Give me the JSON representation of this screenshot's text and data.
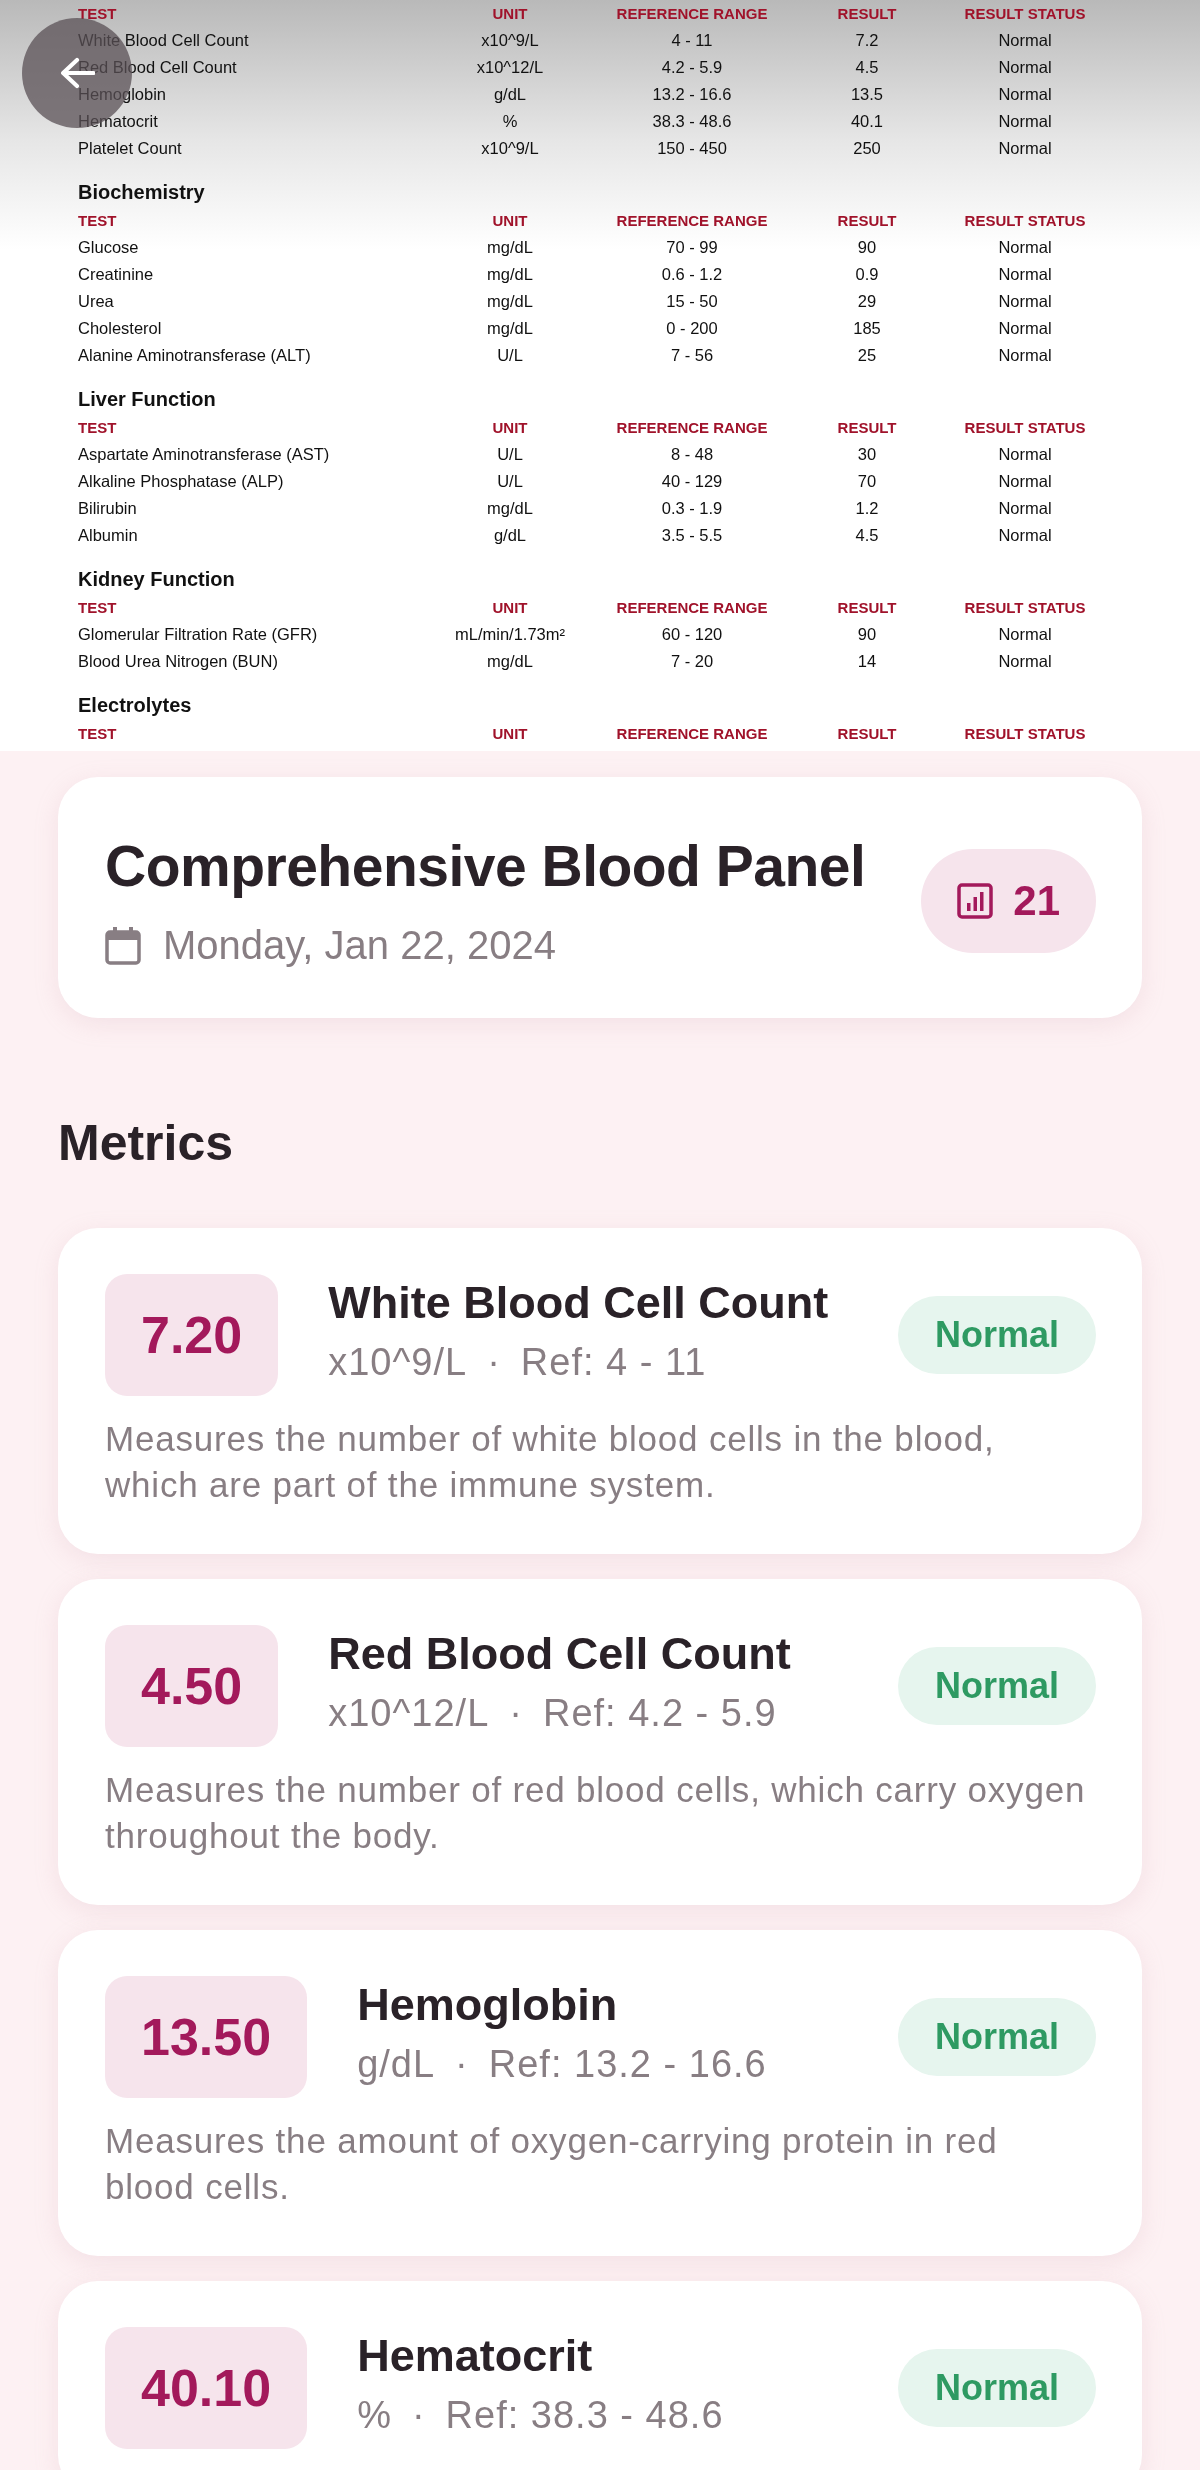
{
  "report": {
    "sections": [
      {
        "columns": [
          "TEST",
          "UNIT",
          "REFERENCE RANGE",
          "RESULT",
          "RESULT STATUS"
        ],
        "rows": [
          [
            "White Blood Cell Count",
            "x10^9/L",
            "4 - 11",
            "7.2",
            "Normal"
          ],
          [
            "Red Blood Cell Count",
            "x10^12/L",
            "4.2 - 5.9",
            "4.5",
            "Normal"
          ],
          [
            "Hemoglobin",
            "g/dL",
            "13.2 - 16.6",
            "13.5",
            "Normal"
          ],
          [
            "Hematocrit",
            "%",
            "38.3 - 48.6",
            "40.1",
            "Normal"
          ],
          [
            "Platelet Count",
            "x10^9/L",
            "150 - 450",
            "250",
            "Normal"
          ]
        ]
      },
      {
        "title": "Biochemistry",
        "columns": [
          "TEST",
          "UNIT",
          "REFERENCE RANGE",
          "RESULT",
          "RESULT STATUS"
        ],
        "rows": [
          [
            "Glucose",
            "mg/dL",
            "70 - 99",
            "90",
            "Normal"
          ],
          [
            "Creatinine",
            "mg/dL",
            "0.6 - 1.2",
            "0.9",
            "Normal"
          ],
          [
            "Urea",
            "mg/dL",
            "15 - 50",
            "29",
            "Normal"
          ],
          [
            "Cholesterol",
            "mg/dL",
            "0 - 200",
            "185",
            "Normal"
          ],
          [
            "Alanine Aminotransferase (ALT)",
            "U/L",
            "7 - 56",
            "25",
            "Normal"
          ]
        ]
      },
      {
        "title": "Liver Function",
        "columns": [
          "TEST",
          "UNIT",
          "REFERENCE RANGE",
          "RESULT",
          "RESULT STATUS"
        ],
        "rows": [
          [
            "Aspartate Aminotransferase (AST)",
            "U/L",
            "8 - 48",
            "30",
            "Normal"
          ],
          [
            "Alkaline Phosphatase (ALP)",
            "U/L",
            "40 - 129",
            "70",
            "Normal"
          ],
          [
            "Bilirubin",
            "mg/dL",
            "0.3 - 1.9",
            "1.2",
            "Normal"
          ],
          [
            "Albumin",
            "g/dL",
            "3.5 - 5.5",
            "4.5",
            "Normal"
          ]
        ]
      },
      {
        "title": "Kidney Function",
        "columns": [
          "TEST",
          "UNIT",
          "REFERENCE RANGE",
          "RESULT",
          "RESULT STATUS"
        ],
        "rows": [
          [
            "Glomerular Filtration Rate (GFR)",
            "mL/min/1.73m²",
            "60 - 120",
            "90",
            "Normal"
          ],
          [
            "Blood Urea Nitrogen (BUN)",
            "mg/dL",
            "7 - 20",
            "14",
            "Normal"
          ]
        ]
      },
      {
        "title": "Electrolytes",
        "columns": [
          "TEST",
          "UNIT",
          "REFERENCE RANGE",
          "RESULT",
          "RESULT STATUS"
        ]
      }
    ]
  },
  "summary": {
    "title": "Comprehensive Blood Panel",
    "date": "Monday, Jan 22, 2024",
    "count": "21"
  },
  "metrics_heading": "Metrics",
  "metrics": [
    {
      "value": "7.20",
      "name": "White Blood Cell Count",
      "unit": "x10^9/L",
      "separator": "·",
      "reference": "Ref: 4 - 11",
      "status": "Normal",
      "description": "Measures the number of white blood cells in the blood, which are part of the immune system."
    },
    {
      "value": "4.50",
      "name": "Red Blood Cell Count",
      "unit": "x10^12/L",
      "separator": "·",
      "reference": "Ref: 4.2 - 5.9",
      "status": "Normal",
      "description": "Measures the number of red blood cells, which carry oxygen throughout the body."
    },
    {
      "value": "13.50",
      "name": "Hemoglobin",
      "unit": "g/dL",
      "separator": "·",
      "reference": "Ref: 13.2 - 16.6",
      "status": "Normal",
      "description": "Measures the amount of oxygen-carrying protein in red blood cells."
    },
    {
      "value": "40.10",
      "name": "Hematocrit",
      "unit": "%",
      "separator": "·",
      "reference": "Ref: 38.3 - 48.6",
      "status": "Normal"
    }
  ]
}
